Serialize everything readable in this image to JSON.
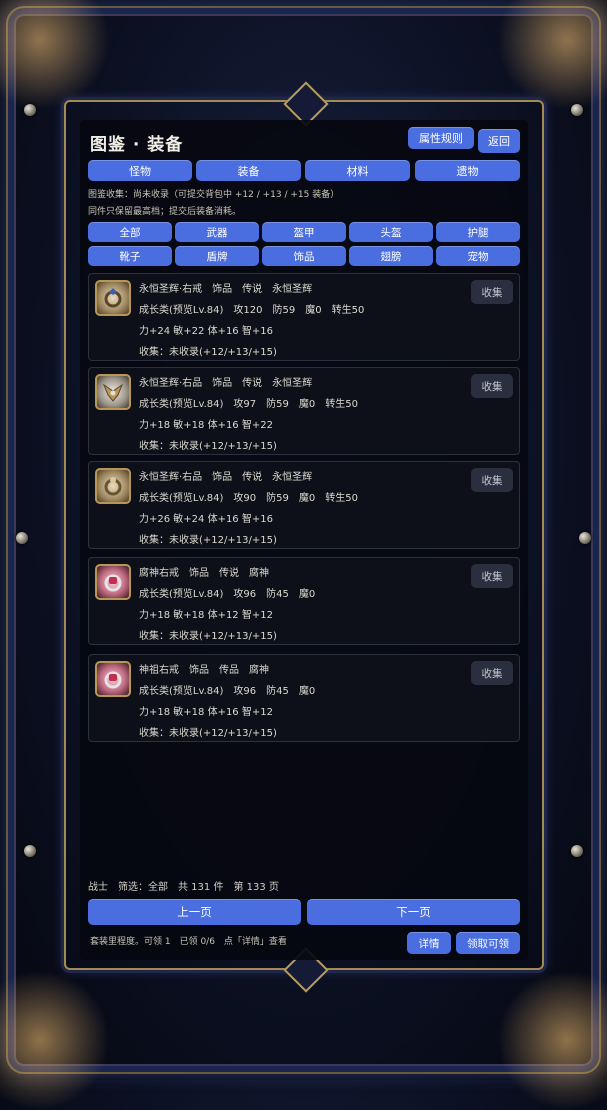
{
  "header": {
    "title": "图鉴 · 装备",
    "attr_rules_label": "属性规则",
    "back_label": "返回"
  },
  "category_tabs": [
    "怪物",
    "装备",
    "材料",
    "遗物"
  ],
  "notes": {
    "line1": "图鉴收集：尚未收录（可提交背包中 +12 / +13 / +15 装备）",
    "line2": "同件只保留最高档；提交后装备消耗。"
  },
  "filters": {
    "row1": [
      "全部",
      "武器",
      "盔甲",
      "头盔",
      "护腿"
    ],
    "row2": [
      "靴子",
      "盾牌",
      "饰品",
      "翅膀",
      "宠物"
    ]
  },
  "items": [
    {
      "name_line": "永恒圣辉·右戒　饰品　传说　永恒圣辉",
      "stats_line": "成长类(预览Lv.84)　攻120　防59　魔0　转生50",
      "attr_line": "力+24 敏+22 体+16 智+16",
      "collect_line": "收集：未收录(+12/+13/+15)",
      "icon": "ring-icon",
      "collect_label": "收集"
    },
    {
      "name_line": "永恒圣辉·右品　饰品　传说　永恒圣辉",
      "stats_line": "成长类(预览Lv.84)　攻97　防59　魔0　转生50",
      "attr_line": "力+18 敏+18 体+16 智+22",
      "collect_line": "收集：未收录(+12/+13/+15)",
      "icon": "amulet-icon",
      "collect_label": "收集"
    },
    {
      "name_line": "永恒圣辉·右品　饰品　传说　永恒圣辉",
      "stats_line": "成长类(预览Lv.84)　攻90　防59　魔0　转生50",
      "attr_line": "力+26 敏+24 体+16 智+16",
      "collect_line": "收集：未收录(+12/+13/+15)",
      "icon": "ring-icon",
      "collect_label": "收集"
    },
    {
      "name_line": "腐神右戒　饰品　传说　腐神",
      "stats_line": "成长类(预览Lv.84)　攻96　防45　魔0",
      "attr_line": "力+18 敏+18 体+12 智+12",
      "collect_line": "收集：未收录(+12/+13/+15)",
      "icon": "ruby-ring-icon",
      "collect_label": "收集"
    },
    {
      "name_line": "神祖右戒　饰品　传品　腐神",
      "stats_line": "成长类(预览Lv.84)　攻96　防45　魔0",
      "attr_line": "力+18 敏+18 体+16 智+12",
      "collect_line": "收集：未收录(+12/+13/+15)",
      "icon": "ruby-ring-icon",
      "collect_label": "收集"
    }
  ],
  "status_line": "战士　筛选：全部　共 131 件　第 133 页",
  "pagination": {
    "prev_label": "上一页",
    "next_label": "下一页"
  },
  "footer": {
    "note": "套装里程度。可领 1　已领 0/6　点「详情」查看",
    "detail_label": "详情",
    "claim_label": "领取可领"
  },
  "colors": {
    "accent": "#4a6ee0",
    "gold_frame": "#a38a52",
    "collect_btn": "#2a2f40"
  }
}
